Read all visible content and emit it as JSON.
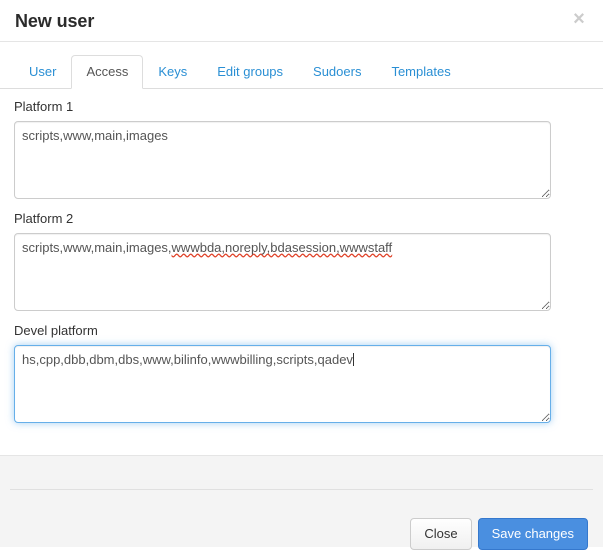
{
  "modal": {
    "title": "New user",
    "close_label": "×",
    "close_icon": "close-icon"
  },
  "tabs": [
    {
      "label": "User",
      "active": false
    },
    {
      "label": "Access",
      "active": true
    },
    {
      "label": "Keys",
      "active": false
    },
    {
      "label": "Edit groups",
      "active": false
    },
    {
      "label": "Sudoers",
      "active": false
    },
    {
      "label": "Templates",
      "active": false
    }
  ],
  "fields": [
    {
      "label": "Platform 1",
      "value": "scripts,www,main,images",
      "value_plain": "scripts,www,main,images",
      "misspelled": "",
      "focused": false
    },
    {
      "label": "Platform 2",
      "value": "scripts,www,main,images,wwwbda,noreply,bdasession,wwwstaff",
      "value_plain": "scripts,www,main,images,",
      "misspelled": "wwwbda,noreply,bdasession,wwwstaff",
      "focused": false
    },
    {
      "label": "Devel platform",
      "value": "hs,cpp,dbb,dbm,dbs,www,bilinfo,wwwbilling,scripts,qadev",
      "value_plain": "hs,cpp,dbb,dbm,dbs,www,bilinfo,wwwbilling,scripts,qadev",
      "misspelled": "",
      "focused": true
    }
  ],
  "footer": {
    "close_button": "Close",
    "save_button": "Save changes"
  },
  "colors": {
    "link": "#2a8fd4",
    "primary_button": "#4a8fe0",
    "focus_border": "#66afe9",
    "spellcheck_underline": "#e0452c",
    "footer_background": "#f4f4f4"
  }
}
